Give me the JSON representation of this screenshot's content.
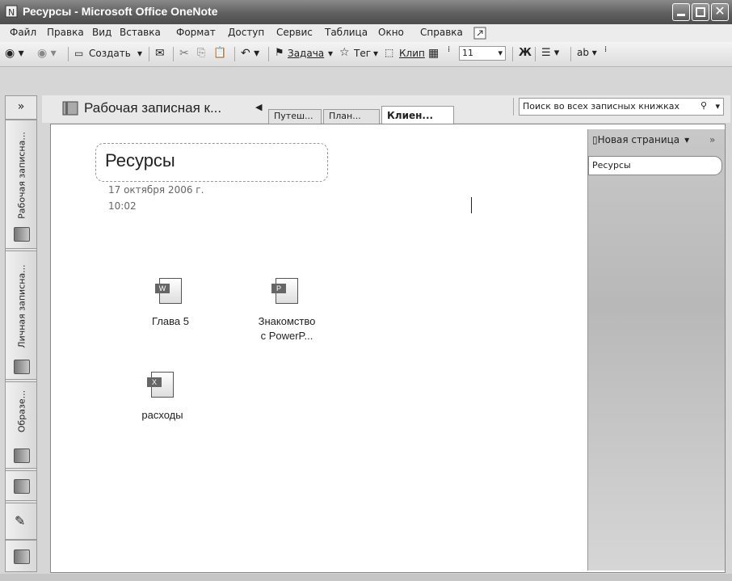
{
  "window": {
    "title": "Ресурсы - Microsoft Office OneNote"
  },
  "menu": [
    "Файл",
    "Правка",
    "Вид",
    "Вставка",
    "Формат",
    "Доступ",
    "Сервис",
    "Таблица",
    "Окно",
    "Справка"
  ],
  "toolbar": {
    "create": "Создать",
    "task": "Задача",
    "tag": "Тег",
    "clip": "Клип",
    "font_size": "11",
    "bold": "Ж"
  },
  "navigation": {
    "collapse": "»",
    "notebooks": [
      "Рабочая записна...",
      "Личная записна...",
      "Образе..."
    ]
  },
  "notebook": {
    "name": "Рабочая записная к...",
    "sections": [
      "Путеш...",
      "План...",
      "Клиен..."
    ],
    "active_section": 2
  },
  "search": {
    "placeholder": "Поиск во всех записных книжках"
  },
  "page": {
    "title": "Ресурсы",
    "date": "17 октября 2006 г.",
    "time": "10:02",
    "files": [
      {
        "name_line1": "Глава 5",
        "name_line2": "",
        "type": "word-document-icon"
      },
      {
        "name_line1": "Знакомство",
        "name_line2": "с PowerP...",
        "type": "powerpoint-document-icon"
      },
      {
        "name_line1": "расходы",
        "name_line2": "",
        "type": "excel-document-icon"
      }
    ]
  },
  "page_tabs": {
    "new_page": "Новая страница",
    "pages": [
      "Ресурсы"
    ]
  }
}
